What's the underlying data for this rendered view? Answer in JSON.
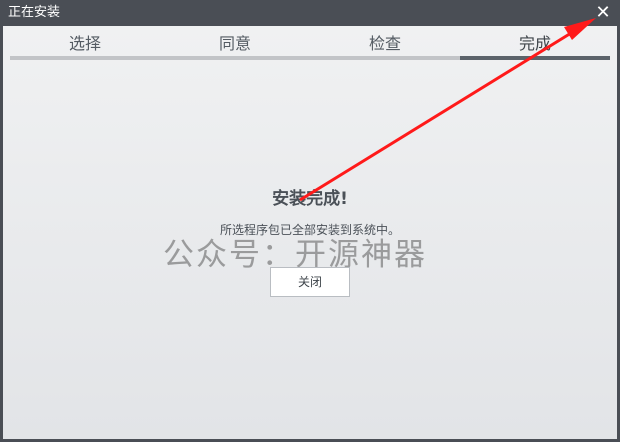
{
  "window": {
    "title": "正在安装",
    "close_icon": "✕"
  },
  "tabs": [
    {
      "label": "选择",
      "active": false
    },
    {
      "label": "同意",
      "active": false
    },
    {
      "label": "检查",
      "active": false
    },
    {
      "label": "完成",
      "active": true
    }
  ],
  "main": {
    "heading": "安装完成!",
    "message": "所选程序包已全部安装到系统中。",
    "close_button_label": "关闭"
  },
  "watermark": "公众号：开源神器",
  "annotation": {
    "arrow_color": "#ff1a1a"
  }
}
